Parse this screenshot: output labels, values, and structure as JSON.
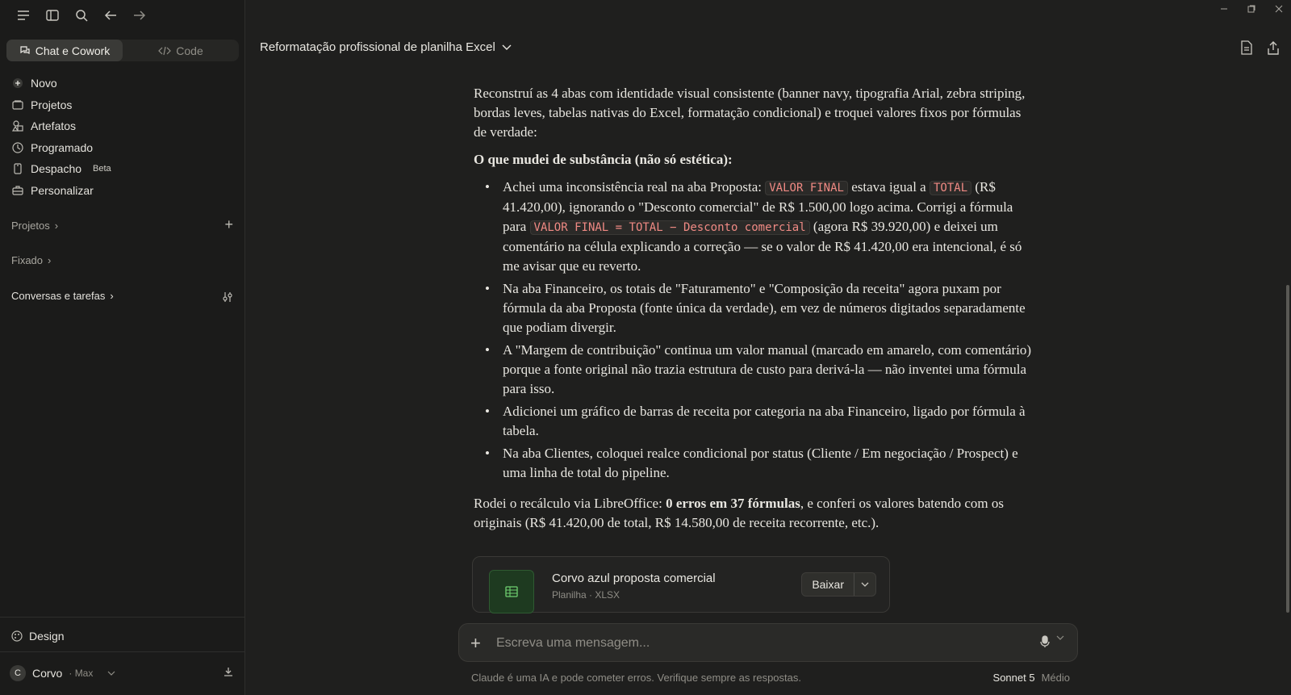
{
  "sidebar": {
    "modes": [
      {
        "label": "Chat e Cowork",
        "icon": "chat-icon"
      },
      {
        "label": "Code",
        "icon": "code-icon"
      }
    ],
    "nav": [
      {
        "label": "Novo",
        "icon": "plus-circle-icon"
      },
      {
        "label": "Projetos",
        "icon": "folder-icon"
      },
      {
        "label": "Artefatos",
        "icon": "shapes-icon"
      },
      {
        "label": "Programado",
        "icon": "clock-icon"
      },
      {
        "label": "Despacho",
        "icon": "phone-icon",
        "badge": "Beta"
      },
      {
        "label": "Personalizar",
        "icon": "briefcase-icon"
      }
    ],
    "sections": {
      "projetos": "Projetos",
      "fixado": "Fixado",
      "conversas": "Conversas e tarefas"
    },
    "design": "Design",
    "user": {
      "initial": "C",
      "name": "Corvo",
      "plan": "· Max"
    }
  },
  "header": {
    "title": "Reformatação profissional de planilha Excel"
  },
  "message": {
    "intro": "Reconstruí as 4 abas com identidade visual consistente (banner navy, tipografia Arial, zebra striping, bordas leves, tabelas nativas do Excel, formatação condicional) e troquei valores fixos por fórmulas de verdade:",
    "heading": "O que mudei de substância (não só estética):",
    "b1_a": "Achei uma inconsistência real na aba Proposta: ",
    "b1_code1": "VALOR FINAL",
    "b1_b": " estava igual a ",
    "b1_code2": "TOTAL",
    "b1_c": " (R$ 41.420,00), ignorando o \"Desconto comercial\" de R$ 1.500,00 logo acima. Corrigi a fórmula para ",
    "b1_code3": "VALOR FINAL = TOTAL − Desconto comercial",
    "b1_d": " (agora R$ 39.920,00) e deixei um comentário na célula explicando a correção — se o valor de R$ 41.420,00 era intencional, é só me avisar que eu reverto.",
    "b2": "Na aba Financeiro, os totais de \"Faturamento\" e \"Composição da receita\" agora puxam por fórmula da aba Proposta (fonte única da verdade), em vez de números digitados separadamente que podiam divergir.",
    "b3": "A \"Margem de contribuição\" continua um valor manual (marcado em amarelo, com comentário) porque a fonte original não trazia estrutura de custo para derivá-la — não inventei uma fórmula para isso.",
    "b4": "Adicionei um gráfico de barras de receita por categoria na aba Financeiro, ligado por fórmula à tabela.",
    "b5": "Na aba Clientes, coloquei realce condicional por status (Cliente / Em negociação / Prospect) e uma linha de total do pipeline.",
    "outro_a": "Rodei o recálculo via LibreOffice: ",
    "outro_bold": "0 erros em 37 fórmulas",
    "outro_b": ", e conferi os valores batendo com os originais (R$ 41.420,00 de total, R$ 14.580,00 de receita recorrente, etc.)."
  },
  "file": {
    "name": "Corvo azul proposta comercial",
    "meta": "Planilha · XLSX",
    "download_label": "Baixar"
  },
  "composer": {
    "placeholder": "Escreva uma mensagem..."
  },
  "footer": {
    "disclaimer": "Claude é uma IA e pode cometer erros. Verifique sempre as respostas.",
    "model": "Sonnet 5",
    "effort": "Médio"
  }
}
